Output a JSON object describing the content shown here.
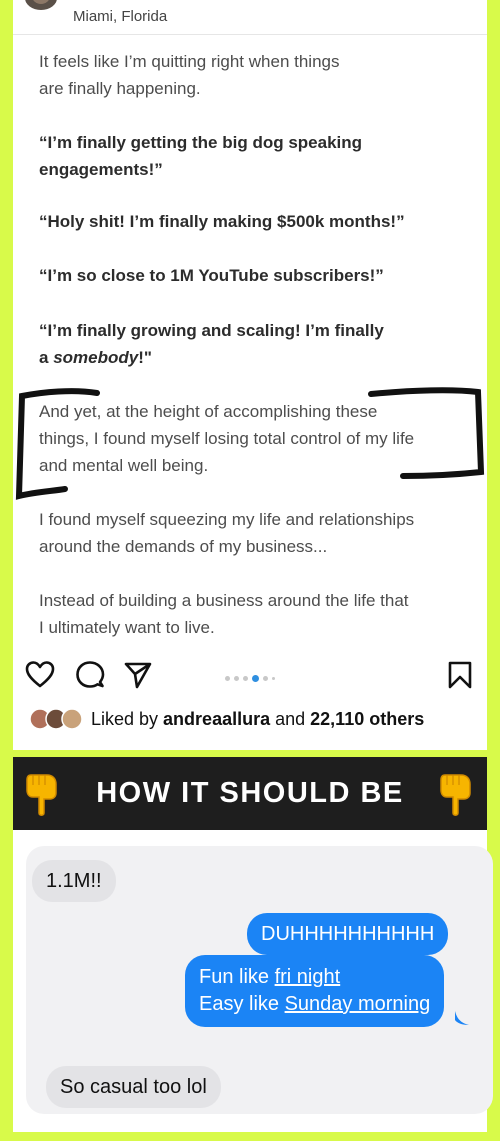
{
  "post": {
    "location": "Miami, Florida",
    "paragraph1": [
      "It feels like I’m quitting right when things",
      "are finally happening."
    ],
    "quote1": [
      "“I’m finally getting the big dog speaking",
      "engagements!”"
    ],
    "quote2": "“Holy shit! I’m finally making $500k months!”",
    "quote3": "“I’m so close to 1M YouTube subscribers!”",
    "quote4_line1": "“I’m finally growing and scaling! I’m finally",
    "quote4_line2_pre": "a ",
    "quote4_line2_em": "somebody",
    "quote4_line2_post": "!\"",
    "paragraph2": [
      "And yet, at the height of accomplishing these",
      "things, I found myself losing total control of my life",
      "and mental well being."
    ],
    "paragraph3": [
      "I found myself squeezing my life and relationships",
      "around the demands of my business..."
    ],
    "paragraph4": [
      "Instead of building a business around the life that",
      "I ultimately want to live."
    ],
    "liked_prefix": "Liked by ",
    "liked_user": "andreaallura",
    "liked_mid": " and ",
    "liked_count": "22,110 others",
    "carousel": {
      "total": 6,
      "active_index": 3
    }
  },
  "banner": {
    "title": "HOW IT SHOULD BE",
    "accent_color": "#f7b500"
  },
  "chat": {
    "msg1": "1.1M!!",
    "msg2": "DUHHHHHHHHHH",
    "msg3_pre": "Fun like ",
    "msg3_link": "fri night",
    "msg4_pre": "Easy like ",
    "msg4_link": "Sunday morning",
    "msg5": "So casual too lol"
  },
  "colors": {
    "background": "#d8fa4a",
    "sent_bubble": "#1b84f5",
    "received_bubble": "#e3e3e6",
    "carousel_active": "#2f8fe0"
  }
}
